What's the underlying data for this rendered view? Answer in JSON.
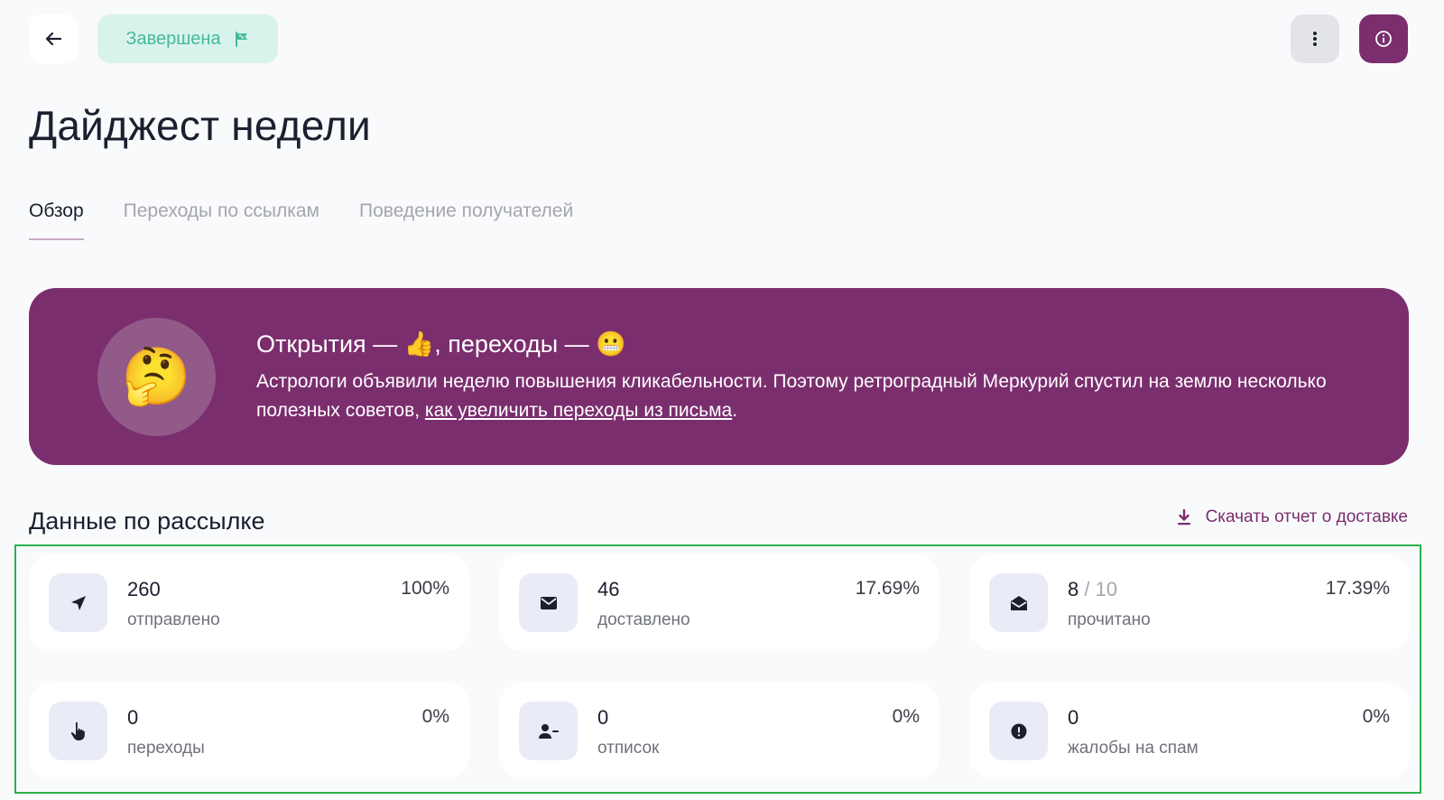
{
  "header": {
    "back_icon": "arrow-left-icon",
    "status_label": "Завершена",
    "status_icon": "flag-icon",
    "menu_icon": "more-vertical-icon",
    "info_icon": "info-circle-icon"
  },
  "page": {
    "title": "Дайджест недели"
  },
  "tabs": [
    {
      "label": "Обзор",
      "active": true
    },
    {
      "label": "Переходы по ссылкам",
      "active": false
    },
    {
      "label": "Поведение получателей",
      "active": false
    }
  ],
  "banner": {
    "emoji": "🤔",
    "title": "Открытия — 👍, переходы — 😬",
    "text_before_link": "Астрологи объявили неделю повышения кликабельности. Поэтому ретроградный Меркурий спустил на землю несколько полезных советов, ",
    "link_text": "как увеличить переходы из письма",
    "text_after_link": "."
  },
  "stats_section": {
    "title": "Данные по рассылке",
    "download_label": "Скачать отчет о доставке",
    "download_icon": "download-icon",
    "cards": [
      {
        "icon": "send-icon",
        "value": "260",
        "value_extra": "",
        "label": "отправлено",
        "percent": "100%"
      },
      {
        "icon": "envelope-icon",
        "value": "46",
        "value_extra": "",
        "label": "доставлено",
        "percent": "17.69%"
      },
      {
        "icon": "envelope-open-icon",
        "value": "8",
        "value_extra": " / 10",
        "label": "прочитано",
        "percent": "17.39%"
      },
      {
        "icon": "pointer-hand-icon",
        "value": "0",
        "value_extra": "",
        "label": "переходы",
        "percent": "0%"
      },
      {
        "icon": "user-minus-icon",
        "value": "0",
        "value_extra": "",
        "label": "отписок",
        "percent": "0%"
      },
      {
        "icon": "alert-circle-icon",
        "value": "0",
        "value_extra": "",
        "label": "жалобы на спам",
        "percent": "0%"
      }
    ]
  },
  "colors": {
    "accent": "#7b2e6e",
    "status_bg": "#d8f3ec",
    "status_text": "#49b79a",
    "highlight_frame": "#2bb24c"
  }
}
